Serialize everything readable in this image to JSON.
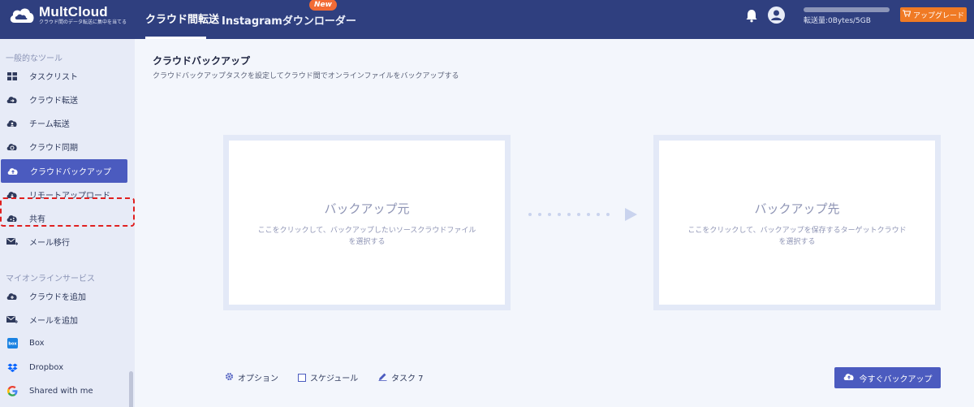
{
  "app": {
    "name": "MultCloud",
    "tagline": "クラウド間のデータ転送に集中を当てる"
  },
  "header": {
    "tabs": [
      {
        "label": "クラウド間転送",
        "active": true
      },
      {
        "label": "Instagramダウンローダー",
        "active": false,
        "badge": "New"
      }
    ],
    "quota_text": "転送量:0Bytes/5GB",
    "upgrade_label": "アップグレード"
  },
  "sidebar": {
    "section_general": "一般的なツール",
    "general_items": [
      {
        "label": "タスクリスト",
        "icon": "grid-icon"
      },
      {
        "label": "クラウド転送",
        "icon": "cloud-transfer-icon"
      },
      {
        "label": "チーム転送",
        "icon": "team-transfer-icon"
      },
      {
        "label": "クラウド同期",
        "icon": "cloud-sync-icon"
      },
      {
        "label": "クラウドバックアップ",
        "icon": "cloud-backup-icon",
        "active": true
      },
      {
        "label": "リモートアップロード",
        "icon": "remote-upload-icon"
      },
      {
        "label": "共有",
        "icon": "share-icon"
      },
      {
        "label": "メール移行",
        "icon": "email-migration-icon"
      }
    ],
    "section_services": "マイオンラインサービス",
    "service_items": [
      {
        "label": "クラウドを追加",
        "icon": "add-cloud-icon"
      },
      {
        "label": "メールを追加",
        "icon": "add-email-icon"
      },
      {
        "label": "Box",
        "icon": "box-icon"
      },
      {
        "label": "Dropbox",
        "icon": "dropbox-icon"
      },
      {
        "label": "Shared with me",
        "icon": "google-icon"
      }
    ]
  },
  "main": {
    "title": "クラウドバックアップ",
    "subtitle": "クラウドバックアップタスクを設定してクラウド間でオンラインファイルをバックアップする",
    "source": {
      "title": "バックアップ元",
      "desc_line1": "ここをクリックして、バックアップしたいソースクラウドファイル",
      "desc_line2": "を選択する"
    },
    "target": {
      "title": "バックアップ先",
      "desc_line1": "ここをクリックして、バックアップを保存するターゲットクラウド",
      "desc_line2": "を選択する"
    },
    "options_label": "オプション",
    "schedule_label": "スケジュール",
    "task_label": "タスク 7",
    "backup_now_label": "今すぐバックアップ"
  },
  "colors": {
    "header_bg": "#2f3f7f",
    "accent": "#4b5bbf",
    "upgrade": "#f07a24",
    "highlight": "#e02020"
  }
}
